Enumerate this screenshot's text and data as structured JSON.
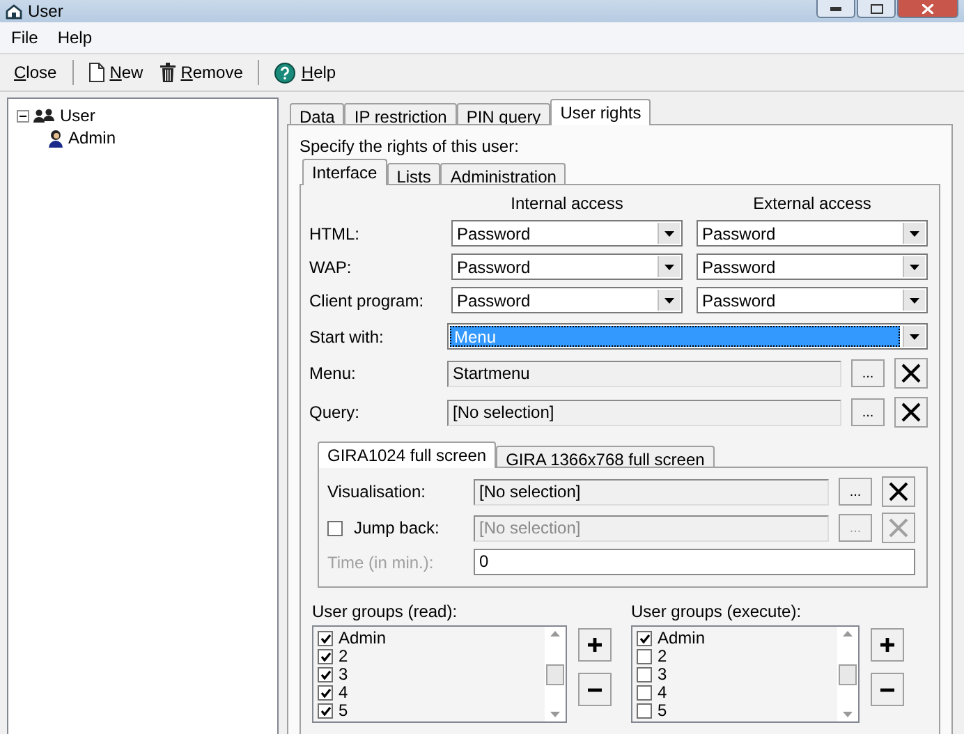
{
  "window": {
    "title": "User"
  },
  "menu": [
    "File",
    "Help"
  ],
  "toolbar": [
    {
      "kind": "close",
      "label": "Close"
    },
    {
      "kind": "new",
      "label": "New"
    },
    {
      "kind": "remove",
      "label": "Remove"
    },
    {
      "kind": "help",
      "label": "Help"
    }
  ],
  "tree": [
    {
      "label": "User",
      "expanded": true,
      "children": [
        {
          "label": "Admin"
        }
      ]
    }
  ],
  "tabs": [
    {
      "label": "Data",
      "selected": false
    },
    {
      "label": "IP restriction",
      "selected": false
    },
    {
      "label": "PIN query",
      "selected": false
    },
    {
      "label": "User rights",
      "selected": true
    }
  ],
  "prompt": "Specify the rights of this user:",
  "subtabs": [
    {
      "label": "Interface",
      "selected": true
    },
    {
      "label": "Lists",
      "selected": false
    },
    {
      "label": "Administration",
      "selected": false
    }
  ],
  "access_columns": [
    "Internal access",
    "External access"
  ],
  "access_rows": [
    {
      "label": "HTML:",
      "internal": "Password",
      "external": "Password"
    },
    {
      "label": "WAP:",
      "internal": "Password",
      "external": "Password"
    },
    {
      "label": "Client program:",
      "internal": "Password",
      "external": "Password"
    }
  ],
  "start_with": {
    "label": "Start with:",
    "value": "Menu"
  },
  "pickers": [
    {
      "label": "Menu:",
      "value": "Startmenu",
      "button": "..."
    },
    {
      "label": "Query:",
      "value": "[No selection]",
      "button": "..."
    }
  ],
  "screen_tabs": [
    {
      "label": "GIRA1024 full screen",
      "selected": true
    },
    {
      "label": "GIRA 1366x768 full screen",
      "selected": false
    }
  ],
  "visualisation": {
    "label": "Visualisation:",
    "value": "[No selection]",
    "button": "..."
  },
  "jump_back": {
    "label": "Jump back:",
    "checked": false,
    "value": "[No selection]",
    "button": "..."
  },
  "time": {
    "label": "Time (in min.):",
    "value": "0"
  },
  "group_lists": [
    {
      "title": "User groups (read):",
      "items": [
        {
          "label": "Admin",
          "checked": true
        },
        {
          "label": "2",
          "checked": true
        },
        {
          "label": "3",
          "checked": true
        },
        {
          "label": "4",
          "checked": true
        },
        {
          "label": "5",
          "checked": true
        }
      ]
    },
    {
      "title": "User groups (execute):",
      "items": [
        {
          "label": "Admin",
          "checked": true
        },
        {
          "label": "2",
          "checked": false
        },
        {
          "label": "3",
          "checked": false
        },
        {
          "label": "4",
          "checked": false
        },
        {
          "label": "5",
          "checked": false
        }
      ]
    }
  ]
}
